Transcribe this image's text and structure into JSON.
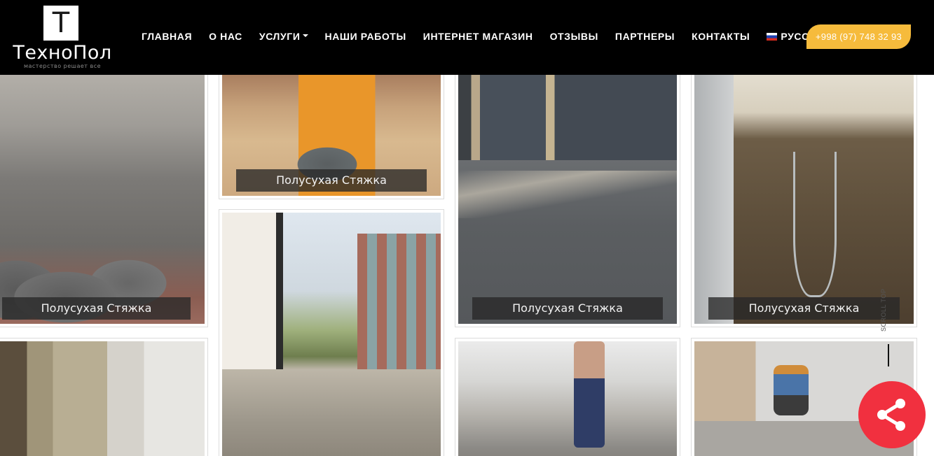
{
  "header": {
    "logo": {
      "letter": "T",
      "name": "ТехноПол",
      "tagline": "мастерство решает все"
    },
    "nav": [
      {
        "label": "ГЛАВНАЯ"
      },
      {
        "label": "О НАС"
      },
      {
        "label": "УСЛУГИ",
        "dropdown": true
      },
      {
        "label": "НАШИ РАБОТЫ"
      },
      {
        "label": "ИНТЕРНЕТ МАГАЗИН"
      },
      {
        "label": "ОТЗЫВЫ"
      },
      {
        "label": "ПАРТНЕРЫ"
      },
      {
        "label": "КОНТАКТЫ"
      }
    ],
    "language": {
      "label": "РУССКИЙ",
      "flag": "russia-flag-icon"
    },
    "phone": "+998 (97) 748 32 93"
  },
  "gallery": {
    "items": [
      {
        "caption": "Полусухая Стяжка"
      },
      {
        "caption": "Полусухая Стяжка"
      },
      {
        "caption": "Полусухая Стяжка"
      },
      {
        "caption": "Полусухая Стяжка"
      },
      {
        "caption": ""
      },
      {
        "caption": ""
      },
      {
        "caption": ""
      },
      {
        "caption": ""
      }
    ]
  },
  "scroll_top": {
    "label": "SCROLL TOP"
  },
  "share": {
    "icon": "share-icon"
  },
  "colors": {
    "header_bg": "#000000",
    "phone_bg": "#f6bb3c",
    "share_bg": "#f1303f"
  }
}
